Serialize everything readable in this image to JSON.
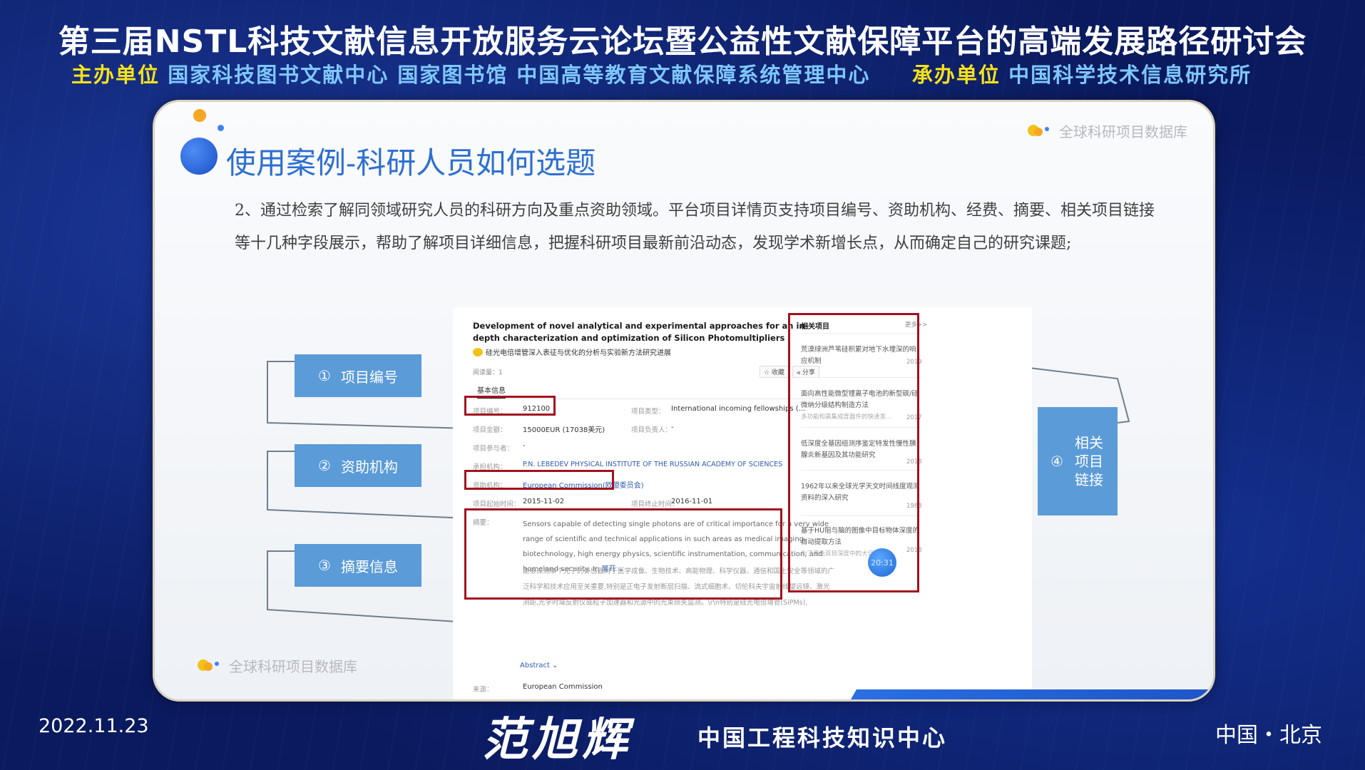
{
  "header": {
    "title": "第三届NSTL科技文献信息开放服务云论坛暨公益性文献保障平台的高端发展路径研讨会",
    "host_label": "主办单位",
    "host_orgs": "国家科技图书文献中心 国家图书馆 中国高等教育文献保障系统管理中心",
    "organizer_label": "承办单位",
    "organizer_org": "中国科学技术信息研究所"
  },
  "slide": {
    "title": "使用案例-科研人员如何选题",
    "brand": "全球科研项目数据库",
    "body": "2、通过检索了解同领域研究人员的科研方向及重点资助领域。平台项目详情页支持项目编号、资助机构、经费、摘要、相关项目链接等十几种字段展示，帮助了解项目详细信息，把握科研项目最新前沿动态，发现学术新增长点，从而确定自己的研究课题;",
    "callouts": {
      "c1_num": "①",
      "c1_label": "项目编号",
      "c2_num": "②",
      "c2_label": "资助机构",
      "c3_num": "③",
      "c3_label": "摘要信息",
      "c4_num": "④",
      "c4_label": "相关项目链接"
    },
    "time_badge": "20:31"
  },
  "screenshot": {
    "title": "Development of novel analytical and experimental approaches for an in-depth characterization and optimization of Silicon Photomultipliers",
    "title_cn": "硅光电倍增管深入表征与优化的分析与实验新方法研究进展",
    "read_count": "阅读量：1",
    "fav_label": "☆ 收藏",
    "share_label": "⪡ 分享",
    "tab_basic": "基本信息",
    "fields": {
      "project_no_label": "项目编号：",
      "project_no_value": "912100",
      "project_type_label": "项目类型：",
      "project_type_value": "International incoming fellowships (...",
      "amount_label": "项目金额：",
      "amount_value": "15000EUR (17038美元)",
      "leader_label": "项目负责人：",
      "leader_value": "-",
      "participants_label": "项目参与者：",
      "participants_value": "-",
      "host_inst_label": "承担机构：",
      "host_inst_value": "P.N. LEBEDEV PHYSICAL INSTITUTE OF THE RUSSIAN ACADEMY OF SCIENCES",
      "funder_label": "资助机构：",
      "funder_value": "European Commission(欧盟委员会)",
      "start_label": "项目起始时间：",
      "start_value": "2015-11-02",
      "end_label": "项目终止时间：",
      "end_value": "2016-11-01",
      "abstract_label": "摘要：",
      "abstract_value": "Sensors capable of detecting single photons are of critical importance for a very wide range of scientific and technical applications in such areas as medical imaging, biotechnology, high energy physics, scientific instrumentation, communication, and homeland security. In",
      "expand": "展开 ⌄",
      "abstract_cn": "能够探测单个光子的传感器对于医学成像、生物技术、高能物理、科学仪器、通信和国土安全等领域的广泛科学和技术应用至关重要,特别是正电子发射断层扫描、流式细胞术、切伦科夫宇宙射线望远镜、激光测距,光学时域反射仪或粒子加速器和光源中的光束损失监测。\\r\\n特别是硅光电倍增管(SiPMs),",
      "abstract_toggle": "Abstract ⌄",
      "source_label": "来源：",
      "source_value": "European Commission"
    },
    "related": {
      "title": "相关项目",
      "more": "更多>>",
      "items": [
        {
          "title": "荒漠绿洲芦苇硅积累对地下水埋深的响应机制",
          "sub": "",
          "year": "2019"
        },
        {
          "title": "面向高性能微型锂离子电池的新型碳/硅微纳分级结构制造方法",
          "sub": "多功能和高集成度器件的快速发...",
          "year": "2017"
        },
        {
          "title": "低深度全基因组测序鉴定特发性慢性胰腺炎新基因及其功能研究",
          "sub": "",
          "year": "2018"
        },
        {
          "title": "1962年以来全球光学天文时间线度观测资料的深入研究",
          "sub": "",
          "year": "1988"
        },
        {
          "title": "基于HU阻与脑的图像中目标物体深度的自动提取方法",
          "sub": "为了避免双目深度中的大误算的...",
          "year": "2018"
        }
      ]
    }
  },
  "footer": {
    "date": "2022.11.23",
    "speaker": "范旭辉",
    "org": "中国工程科技知识中心",
    "location": "中国・北京"
  }
}
